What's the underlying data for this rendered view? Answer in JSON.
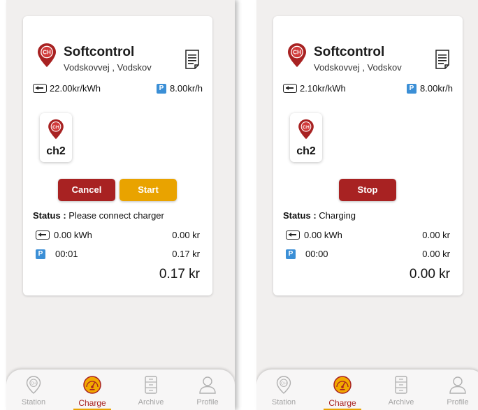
{
  "screens": [
    {
      "site": {
        "name": "Softcontrol",
        "address": "Vodskovvej , Vodskov",
        "pin_text": "CH"
      },
      "prices": {
        "energy": "22.00kr/kWh",
        "parking_badge": "P",
        "parking": "8.00kr/h"
      },
      "connector": {
        "label": "ch2",
        "pin_text": "CH"
      },
      "buttons": {
        "cancel": "Cancel",
        "start": "Start"
      },
      "status": {
        "label": "Status :",
        "value": " Please connect charger"
      },
      "meter": {
        "energy": "0.00 kWh",
        "energy_cost": "0.00 kr",
        "parking_badge": "P",
        "parking_time": "00:01",
        "parking_cost": "0.17 kr",
        "total": "0.17 kr"
      }
    },
    {
      "site": {
        "name": "Softcontrol",
        "address": "Vodskovvej , Vodskov",
        "pin_text": "CH"
      },
      "prices": {
        "energy": "2.10kr/kWh",
        "parking_badge": "P",
        "parking": "8.00kr/h"
      },
      "connector": {
        "label": "ch2",
        "pin_text": "CH"
      },
      "buttons": {
        "stop": "Stop"
      },
      "status": {
        "label": "Status :",
        "value": " Charging"
      },
      "meter": {
        "energy": "0.00 kWh",
        "energy_cost": "0.00 kr",
        "parking_badge": "P",
        "parking_time": "00:00",
        "parking_cost": "0.00 kr",
        "total": "0.00 kr"
      }
    }
  ],
  "nav": {
    "station": "Station",
    "charge": "Charge",
    "archive": "Archive",
    "profile": "Profile",
    "station_icon_text": "CH"
  },
  "colors": {
    "brand_red": "#a82222",
    "accent_amber": "#e9a300",
    "parking_blue": "#3b8fd6",
    "nav_inactive": "#a4a4a4"
  }
}
